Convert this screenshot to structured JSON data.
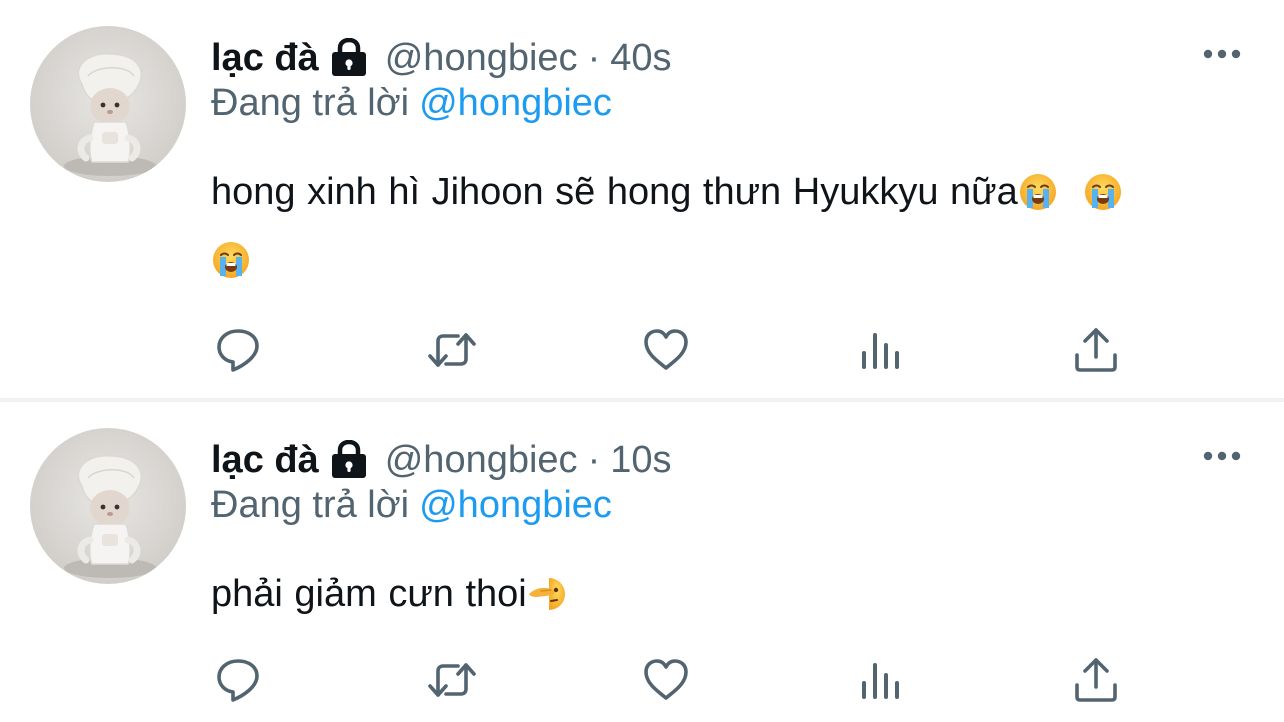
{
  "tweets": [
    {
      "display_name": "lạc đà",
      "handle": "@hongbiec",
      "separator": "·",
      "time": "40s",
      "replying_prefix": "Đang trả lời",
      "replying_to": "@hongbiec",
      "text": "hong xinh hì Jihoon sẽ hong thưn Hyukkyu nữa",
      "trailing_emoji": [
        "loudly-crying-face-emoji",
        "loudly-crying-face-emoji",
        "loudly-crying-face-emoji"
      ]
    },
    {
      "display_name": "lạc đà",
      "handle": "@hongbiec",
      "separator": "·",
      "time": "10s",
      "replying_prefix": "Đang trả lời",
      "replying_to": "@hongbiec",
      "text": "phải giảm cưn thoi",
      "trailing_emoji": [
        "face-peeking-emoji"
      ]
    }
  ],
  "icons": {
    "lock": "lock-icon",
    "more": "more-options-icon",
    "reply": "reply-icon",
    "retweet": "retweet-icon",
    "like": "heart-icon",
    "views": "views-chart-icon",
    "share": "share-upload-icon"
  },
  "colors": {
    "text_primary": "#0f1419",
    "text_secondary": "#536471",
    "link": "#1d9bf0",
    "divider": "#eff3f4"
  }
}
